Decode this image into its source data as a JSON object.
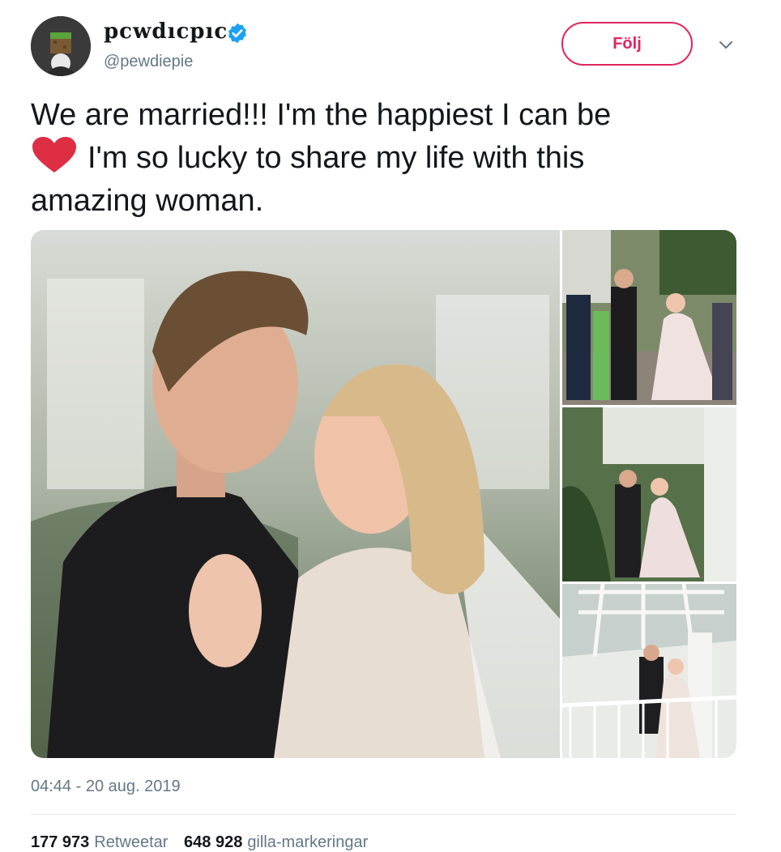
{
  "author": {
    "display_name": "pcwdıcpıc",
    "handle": "@pewdiepie",
    "verified": true,
    "avatar_icon": "grass-block-avatar"
  },
  "actions": {
    "follow_label": "Följ",
    "more_icon": "chevron-down-icon"
  },
  "tweet": {
    "line1": "We are married!!! I'm the happiest I can be",
    "line2_after_heart": "I'm so lucky to share my life with this",
    "line3": "amazing woman.",
    "emoji": "red-heart"
  },
  "media": {
    "photo_count": 4,
    "photos": [
      "couple-closeup",
      "couple-walking-crowd",
      "couple-stairs-greenhouse",
      "couple-balcony-greenhouse"
    ]
  },
  "meta": {
    "timestamp": "04:44 - 20 aug. 2019"
  },
  "stats": {
    "retweets_count": "177 973",
    "retweets_label": "Retweetar",
    "likes_count": "648 928",
    "likes_label": "gilla-markeringar"
  },
  "colors": {
    "accent": "#e0245e",
    "verified": "#1da1f2",
    "secondary_text": "#657786",
    "text": "#14171a"
  }
}
